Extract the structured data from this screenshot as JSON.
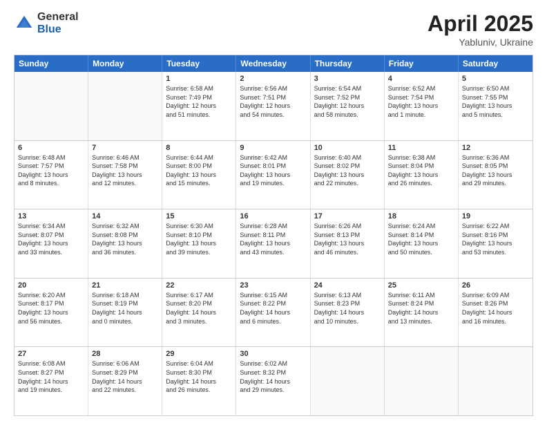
{
  "header": {
    "logo_general": "General",
    "logo_blue": "Blue",
    "title": "April 2025",
    "location": "Yabluniv, Ukraine"
  },
  "weekdays": [
    "Sunday",
    "Monday",
    "Tuesday",
    "Wednesday",
    "Thursday",
    "Friday",
    "Saturday"
  ],
  "rows": [
    [
      {
        "day": "",
        "empty": true
      },
      {
        "day": "",
        "empty": true
      },
      {
        "day": "1",
        "sun": "Sunrise: 6:58 AM\nSunset: 7:49 PM\nDaylight: 12 hours\nand 51 minutes."
      },
      {
        "day": "2",
        "sun": "Sunrise: 6:56 AM\nSunset: 7:51 PM\nDaylight: 12 hours\nand 54 minutes."
      },
      {
        "day": "3",
        "sun": "Sunrise: 6:54 AM\nSunset: 7:52 PM\nDaylight: 12 hours\nand 58 minutes."
      },
      {
        "day": "4",
        "sun": "Sunrise: 6:52 AM\nSunset: 7:54 PM\nDaylight: 13 hours\nand 1 minute."
      },
      {
        "day": "5",
        "sun": "Sunrise: 6:50 AM\nSunset: 7:55 PM\nDaylight: 13 hours\nand 5 minutes."
      }
    ],
    [
      {
        "day": "6",
        "sun": "Sunrise: 6:48 AM\nSunset: 7:57 PM\nDaylight: 13 hours\nand 8 minutes."
      },
      {
        "day": "7",
        "sun": "Sunrise: 6:46 AM\nSunset: 7:58 PM\nDaylight: 13 hours\nand 12 minutes."
      },
      {
        "day": "8",
        "sun": "Sunrise: 6:44 AM\nSunset: 8:00 PM\nDaylight: 13 hours\nand 15 minutes."
      },
      {
        "day": "9",
        "sun": "Sunrise: 6:42 AM\nSunset: 8:01 PM\nDaylight: 13 hours\nand 19 minutes."
      },
      {
        "day": "10",
        "sun": "Sunrise: 6:40 AM\nSunset: 8:02 PM\nDaylight: 13 hours\nand 22 minutes."
      },
      {
        "day": "11",
        "sun": "Sunrise: 6:38 AM\nSunset: 8:04 PM\nDaylight: 13 hours\nand 26 minutes."
      },
      {
        "day": "12",
        "sun": "Sunrise: 6:36 AM\nSunset: 8:05 PM\nDaylight: 13 hours\nand 29 minutes."
      }
    ],
    [
      {
        "day": "13",
        "sun": "Sunrise: 6:34 AM\nSunset: 8:07 PM\nDaylight: 13 hours\nand 33 minutes."
      },
      {
        "day": "14",
        "sun": "Sunrise: 6:32 AM\nSunset: 8:08 PM\nDaylight: 13 hours\nand 36 minutes."
      },
      {
        "day": "15",
        "sun": "Sunrise: 6:30 AM\nSunset: 8:10 PM\nDaylight: 13 hours\nand 39 minutes."
      },
      {
        "day": "16",
        "sun": "Sunrise: 6:28 AM\nSunset: 8:11 PM\nDaylight: 13 hours\nand 43 minutes."
      },
      {
        "day": "17",
        "sun": "Sunrise: 6:26 AM\nSunset: 8:13 PM\nDaylight: 13 hours\nand 46 minutes."
      },
      {
        "day": "18",
        "sun": "Sunrise: 6:24 AM\nSunset: 8:14 PM\nDaylight: 13 hours\nand 50 minutes."
      },
      {
        "day": "19",
        "sun": "Sunrise: 6:22 AM\nSunset: 8:16 PM\nDaylight: 13 hours\nand 53 minutes."
      }
    ],
    [
      {
        "day": "20",
        "sun": "Sunrise: 6:20 AM\nSunset: 8:17 PM\nDaylight: 13 hours\nand 56 minutes."
      },
      {
        "day": "21",
        "sun": "Sunrise: 6:18 AM\nSunset: 8:19 PM\nDaylight: 14 hours\nand 0 minutes."
      },
      {
        "day": "22",
        "sun": "Sunrise: 6:17 AM\nSunset: 8:20 PM\nDaylight: 14 hours\nand 3 minutes."
      },
      {
        "day": "23",
        "sun": "Sunrise: 6:15 AM\nSunset: 8:22 PM\nDaylight: 14 hours\nand 6 minutes."
      },
      {
        "day": "24",
        "sun": "Sunrise: 6:13 AM\nSunset: 8:23 PM\nDaylight: 14 hours\nand 10 minutes."
      },
      {
        "day": "25",
        "sun": "Sunrise: 6:11 AM\nSunset: 8:24 PM\nDaylight: 14 hours\nand 13 minutes."
      },
      {
        "day": "26",
        "sun": "Sunrise: 6:09 AM\nSunset: 8:26 PM\nDaylight: 14 hours\nand 16 minutes."
      }
    ],
    [
      {
        "day": "27",
        "sun": "Sunrise: 6:08 AM\nSunset: 8:27 PM\nDaylight: 14 hours\nand 19 minutes."
      },
      {
        "day": "28",
        "sun": "Sunrise: 6:06 AM\nSunset: 8:29 PM\nDaylight: 14 hours\nand 22 minutes."
      },
      {
        "day": "29",
        "sun": "Sunrise: 6:04 AM\nSunset: 8:30 PM\nDaylight: 14 hours\nand 26 minutes."
      },
      {
        "day": "30",
        "sun": "Sunrise: 6:02 AM\nSunset: 8:32 PM\nDaylight: 14 hours\nand 29 minutes."
      },
      {
        "day": "",
        "empty": true
      },
      {
        "day": "",
        "empty": true
      },
      {
        "day": "",
        "empty": true
      }
    ]
  ]
}
